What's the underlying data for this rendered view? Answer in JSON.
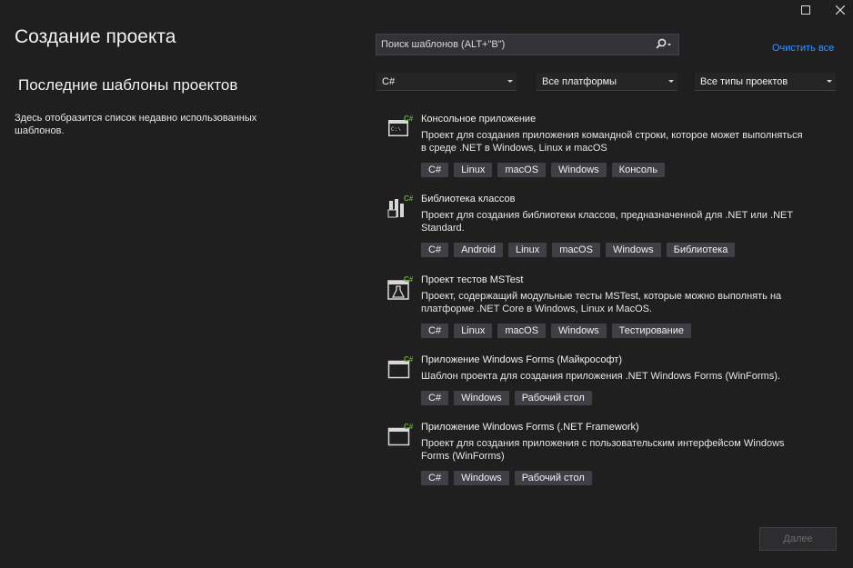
{
  "window": {
    "maximize_icon": "maximize-icon",
    "close_icon": "close-icon"
  },
  "page_title": "Создание проекта",
  "recent": {
    "title": "Последние шаблоны проектов",
    "description": "Здесь отобразится список недавно использованных шаблонов."
  },
  "search": {
    "placeholder": "Поиск шаблонов (ALT+\"В\")",
    "icon": "search-icon"
  },
  "clear_all": "Очистить все",
  "filters": {
    "language": "C#",
    "platform": "Все платформы",
    "project_type": "Все типы проектов"
  },
  "templates": [
    {
      "icon": "console-app-icon",
      "name": "Консольное приложение",
      "description": "Проект для создания приложения командной строки, которое может выполняться в среде .NET в Windows, Linux и macOS",
      "tags": [
        "C#",
        "Linux",
        "macOS",
        "Windows",
        "Консоль"
      ]
    },
    {
      "icon": "class-library-icon",
      "name": "Библиотека классов",
      "description": "Проект для создания библиотеки классов, предназначенной для .NET или .NET Standard.",
      "tags": [
        "C#",
        "Android",
        "Linux",
        "macOS",
        "Windows",
        "Библиотека"
      ]
    },
    {
      "icon": "mstest-icon",
      "name": "Проект тестов MSTest",
      "description": "Проект, содержащий модульные тесты MSTest, которые можно выполнять на платформе .NET Core в Windows, Linux и MacOS.",
      "tags": [
        "C#",
        "Linux",
        "macOS",
        "Windows",
        "Тестирование"
      ]
    },
    {
      "icon": "windows-forms-icon",
      "name": "Приложение Windows Forms (Майкрософт)",
      "description": "Шаблон проекта для создания приложения .NET Windows Forms (WinForms).",
      "tags": [
        "C#",
        "Windows",
        "Рабочий стол"
      ]
    },
    {
      "icon": "windows-forms-framework-icon",
      "name": "Приложение Windows Forms (.NET Framework)",
      "description": "Проект для создания приложения с пользовательским интерфейсом Windows Forms (WinForms)",
      "tags": [
        "C#",
        "Windows",
        "Рабочий стол"
      ]
    }
  ],
  "next_button": "Далее",
  "colors": {
    "background": "#1f1f1f",
    "tag_bg": "#3f3f46",
    "link": "#3794ff",
    "csharp_green": "#6aad38"
  }
}
